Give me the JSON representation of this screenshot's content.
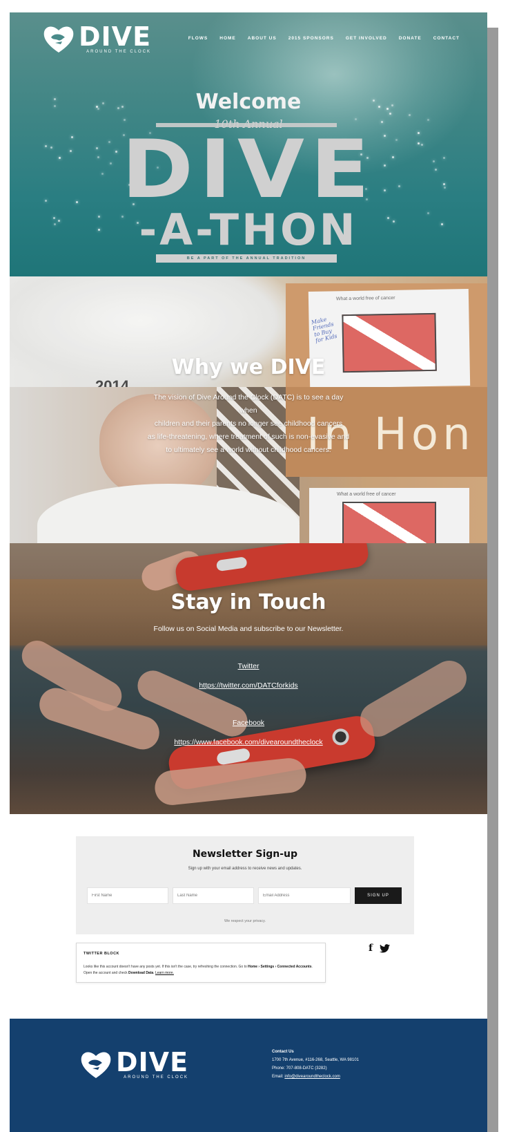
{
  "brand": {
    "logo_word": "DIVE",
    "logo_tagline": "AROUND THE CLOCK"
  },
  "nav": {
    "items": [
      "FLOWS",
      "HOME",
      "ABOUT US",
      "2015 SPONSORS",
      "GET INVOLVED",
      "DONATE",
      "CONTACT"
    ]
  },
  "hero": {
    "welcome": "Welcome",
    "annual": "10th Annual",
    "title_line1": "DIVE",
    "title_line2": "-A-THON",
    "tagline": "BE A PART OF THE ANNUAL TRADITION"
  },
  "why": {
    "title": "Why we DIVE",
    "body_lines": [
      "The vision of Dive Around the Clock (DATC) is to see a day",
      "when",
      "children and their parents no longer see childhood cancers",
      "as life-threatening, where treatment of such is non-evasive and",
      "to ultimately see a world without childhood cancers."
    ],
    "photo_text": {
      "year": "2014",
      "paper_caption": "What a world free of cancer",
      "handwritten": "Make Friends to Buy for Kids",
      "sign": "In Hon"
    }
  },
  "stay": {
    "title": "Stay in Touch",
    "subtitle": "Follow us on Social Media and subscribe to our Newsletter.",
    "twitter_label": "Twitter",
    "twitter_url": "https://twitter.com/DATCforkids",
    "facebook_label": "Facebook",
    "facebook_url": "https://www.facebook.com/divearoundtheclock"
  },
  "newsletter": {
    "title": "Newsletter Sign-up",
    "description": "Sign up with your email address to receive news and updates.",
    "first_name_placeholder": "First Name",
    "last_name_placeholder": "Last Name",
    "email_placeholder": "Email Address",
    "button_label": "SIGN UP",
    "privacy": "We respect your privacy."
  },
  "twitter_block": {
    "title": "TWITTER BLOCK",
    "text_1": "Looks like this account doesn't have any posts yet. If this isn't the case, try refreshing the connection. Go to",
    "bold_1": "Home › Settings › Connected Accounts",
    "text_2": ". Open the account and check",
    "bold_2": "Download Data",
    "text_3": ".",
    "link": "Learn more."
  },
  "social_icons": [
    "facebook-icon",
    "twitter-icon"
  ],
  "footer": {
    "contact_heading": "Contact Us",
    "address": "1700 7th Avenue, #116-268, Seattle, WA 98101",
    "phone": "Phone: 707-808-DATC (3282)",
    "email_label": "Email:",
    "email": "info@divearoundtheclock.com"
  },
  "colors": {
    "hero_teal": "#2a7e82",
    "footer_blue": "#14406e",
    "button_black": "#1a1a1a",
    "newsletter_bg": "#eeeeee"
  }
}
